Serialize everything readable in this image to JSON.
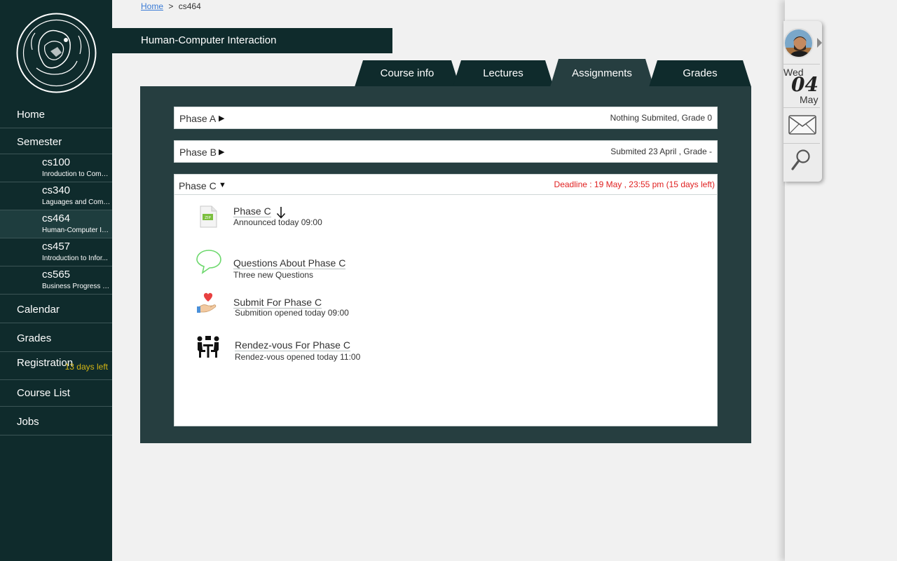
{
  "breadcrumb": {
    "home": "Home",
    "sep": ">",
    "current": "cs464"
  },
  "course_title": "Human-Computer Interaction",
  "sidebar": {
    "home": "Home",
    "semester": "Semester",
    "courses": [
      {
        "code": "cs100",
        "name": "Inroduction to Comp..."
      },
      {
        "code": "cs340",
        "name": "Laguages and Compi..."
      },
      {
        "code": "cs464",
        "name": "Human-Computer In..."
      },
      {
        "code": "cs457",
        "name": "Introduction to Infor..."
      },
      {
        "code": "cs565",
        "name": "Business Progress M..."
      }
    ],
    "calendar": "Calendar",
    "grades": "Grades",
    "registration": "Registration",
    "registration_days": "13 days left",
    "course_list": "Course List",
    "jobs": "Jobs"
  },
  "tabs": [
    "Course info",
    "Lectures",
    "Assignments",
    "Grades"
  ],
  "active_tab": "Assignments",
  "phases": [
    {
      "title": "Phase A",
      "arrow": "▶",
      "status": "Nothing Submited, Grade 0"
    },
    {
      "title": "Phase B",
      "arrow": "▶",
      "status": "Submited 23 April , Grade -"
    }
  ],
  "phase_c": {
    "title": "Phase C",
    "arrow": "▼",
    "deadline": "Deadline : 19 May , 23:55 pm  (15 days left)",
    "items": [
      {
        "icon": "zip-file-icon",
        "title": "Phase C",
        "sub": "Announced today 09:00",
        "extra_icon": "download-arrow-icon"
      },
      {
        "icon": "speech-bubble-icon",
        "title": "Questions About Phase C",
        "sub": "Three new Questions"
      },
      {
        "icon": "heart-hand-icon",
        "title": "Submit For Phase C",
        "sub": "Submition opened today 09:00"
      },
      {
        "icon": "meeting-icon",
        "title": "Rendez-vous For Phase C",
        "sub": "Rendez-vous opened today 11:00"
      }
    ]
  },
  "widget": {
    "day": "Wed",
    "date": "04",
    "month": "May"
  },
  "colors": {
    "sidebar": "#0f2b2c",
    "panel": "#263e40",
    "deadline": "#e02020",
    "registration_days": "#d4b514"
  }
}
